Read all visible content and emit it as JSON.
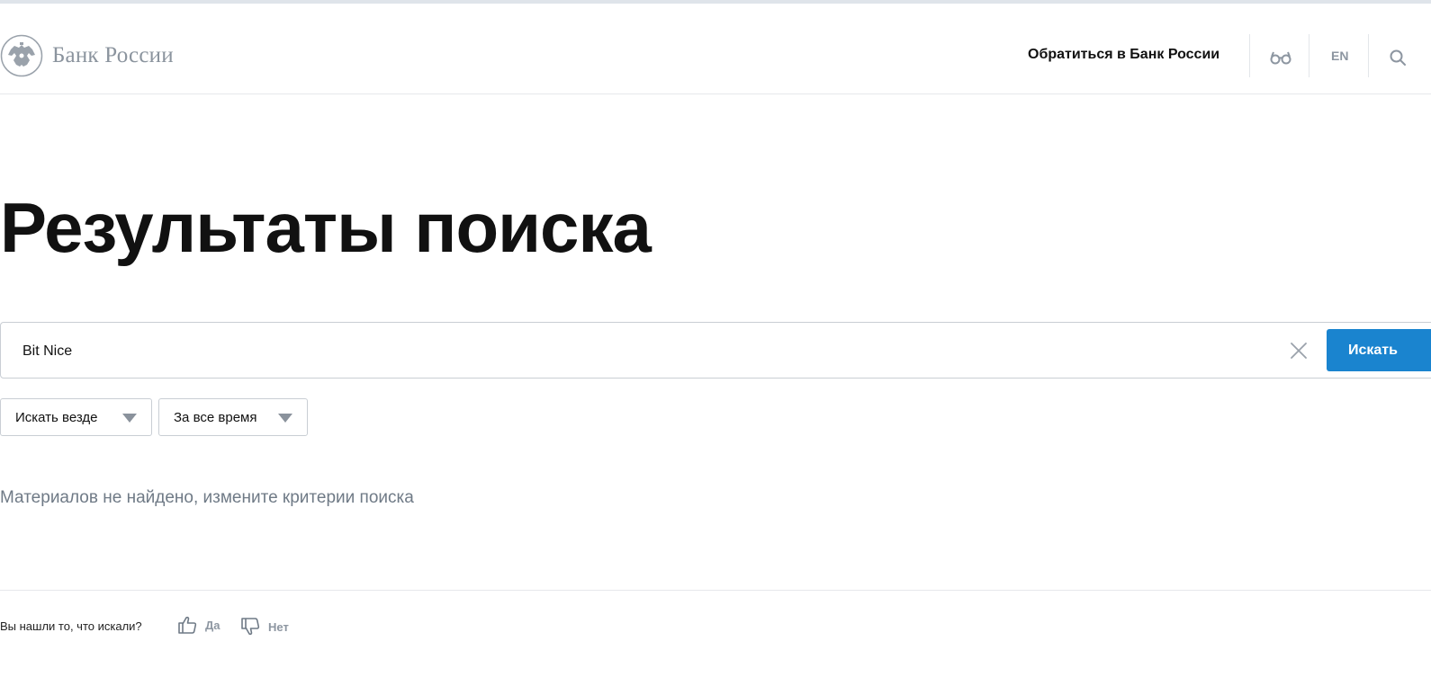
{
  "header": {
    "logo_text": "Банк России",
    "contact_link": "Обратиться в Банк России",
    "lang_label": "EN"
  },
  "main": {
    "title": "Результаты поиска",
    "search": {
      "value": "Bit Nice",
      "submit_label": "Искать"
    },
    "filters": {
      "scope_label": "Искать везде",
      "period_label": "За все время"
    },
    "no_results_text": "Материалов не найдено, измените критерии поиска"
  },
  "feedback": {
    "question": "Вы нашли то, что искали?",
    "yes_label": "Да",
    "no_label": "Нет"
  },
  "colors": {
    "accent_button": "#1a84cf",
    "muted_text": "#6f7a86"
  },
  "icons": {
    "logo": "double-headed-eagle-emblem-icon",
    "accessibility": "glasses-icon",
    "header_search": "search-icon",
    "clear": "close-icon",
    "dropdown": "caret-down-icon",
    "yes": "thumbs-up-icon",
    "no": "thumbs-down-icon"
  }
}
